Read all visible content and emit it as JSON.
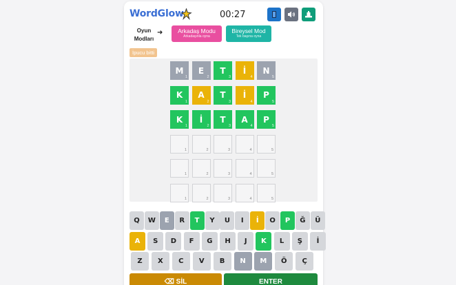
{
  "app": {
    "title": "WordGlow",
    "timer": "00:27"
  },
  "colors": {
    "correct": "#22c55e",
    "present": "#eab308",
    "absent": "#9ca3af",
    "key_default": "#d5d7db",
    "brand": "#3b6fd4"
  },
  "header_buttons": [
    {
      "name": "book-icon",
      "color": "#1d73c9"
    },
    {
      "name": "sound-icon",
      "color": "#6b7280"
    },
    {
      "name": "stats-icon",
      "color": "#0f9d7a"
    }
  ],
  "modes": {
    "label": "Oyun Modları",
    "arrow": "➜",
    "friend": {
      "title": "Arkadaş Modu",
      "subtitle": "Arkadaşınla oyna",
      "color": "#e94fa0"
    },
    "solo": {
      "title": "Bireysel Mod",
      "subtitle": "Tek başına oyna",
      "color": "#1fb5a6"
    }
  },
  "hint_badge": "İpucu bitti",
  "board": {
    "rows": [
      [
        {
          "letter": "M",
          "state": "absent"
        },
        {
          "letter": "E",
          "state": "absent"
        },
        {
          "letter": "T",
          "state": "correct"
        },
        {
          "letter": "İ",
          "state": "present"
        },
        {
          "letter": "N",
          "state": "absent"
        }
      ],
      [
        {
          "letter": "K",
          "state": "correct"
        },
        {
          "letter": "A",
          "state": "present"
        },
        {
          "letter": "T",
          "state": "correct"
        },
        {
          "letter": "İ",
          "state": "present"
        },
        {
          "letter": "P",
          "state": "correct"
        }
      ],
      [
        {
          "letter": "K",
          "state": "correct"
        },
        {
          "letter": "İ",
          "state": "correct"
        },
        {
          "letter": "T",
          "state": "correct"
        },
        {
          "letter": "A",
          "state": "correct"
        },
        {
          "letter": "P",
          "state": "correct"
        }
      ],
      [
        {
          "letter": "",
          "state": "empty"
        },
        {
          "letter": "",
          "state": "empty"
        },
        {
          "letter": "",
          "state": "empty"
        },
        {
          "letter": "",
          "state": "empty"
        },
        {
          "letter": "",
          "state": "empty"
        }
      ],
      [
        {
          "letter": "",
          "state": "empty"
        },
        {
          "letter": "",
          "state": "empty"
        },
        {
          "letter": "",
          "state": "empty"
        },
        {
          "letter": "",
          "state": "empty"
        },
        {
          "letter": "",
          "state": "empty"
        }
      ],
      [
        {
          "letter": "",
          "state": "empty"
        },
        {
          "letter": "",
          "state": "empty"
        },
        {
          "letter": "",
          "state": "empty"
        },
        {
          "letter": "",
          "state": "empty"
        },
        {
          "letter": "",
          "state": "empty"
        }
      ]
    ],
    "numbers": [
      "1",
      "2",
      "3",
      "4",
      "5"
    ]
  },
  "keyboard": {
    "rows": [
      [
        {
          "k": "Q",
          "s": "default"
        },
        {
          "k": "W",
          "s": "default"
        },
        {
          "k": "E",
          "s": "absent"
        },
        {
          "k": "R",
          "s": "default"
        },
        {
          "k": "T",
          "s": "correct"
        },
        {
          "k": "Y",
          "s": "default"
        },
        {
          "k": "U",
          "s": "default"
        },
        {
          "k": "I",
          "s": "default"
        },
        {
          "k": "İ",
          "s": "present"
        },
        {
          "k": "O",
          "s": "default"
        },
        {
          "k": "P",
          "s": "correct"
        },
        {
          "k": "Ğ",
          "s": "default"
        },
        {
          "k": "Ü",
          "s": "default"
        }
      ],
      [
        {
          "k": "A",
          "s": "present"
        },
        {
          "k": "S",
          "s": "default"
        },
        {
          "k": "D",
          "s": "default"
        },
        {
          "k": "F",
          "s": "default"
        },
        {
          "k": "G",
          "s": "default"
        },
        {
          "k": "H",
          "s": "default"
        },
        {
          "k": "J",
          "s": "default"
        },
        {
          "k": "K",
          "s": "correct"
        },
        {
          "k": "L",
          "s": "default"
        },
        {
          "k": "Ş",
          "s": "default"
        },
        {
          "k": "İ",
          "s": "default"
        }
      ],
      [
        {
          "k": "Z",
          "s": "default"
        },
        {
          "k": "X",
          "s": "default"
        },
        {
          "k": "C",
          "s": "default"
        },
        {
          "k": "V",
          "s": "default"
        },
        {
          "k": "B",
          "s": "default"
        },
        {
          "k": "N",
          "s": "absent"
        },
        {
          "k": "M",
          "s": "absent"
        },
        {
          "k": "Ö",
          "s": "default"
        },
        {
          "k": "Ç",
          "s": "default"
        }
      ]
    ],
    "delete_label": "⌫ SİL",
    "delete_color": "#ca8a04",
    "enter_label": "ENTER",
    "enter_color": "#1e8a3e"
  }
}
